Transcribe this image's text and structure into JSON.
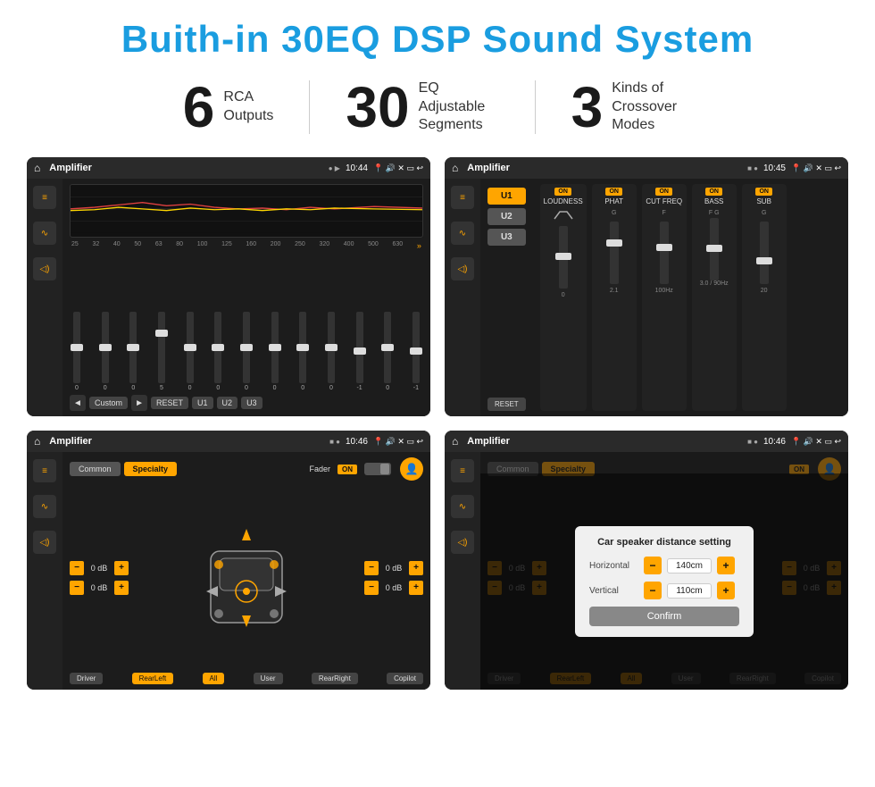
{
  "header": {
    "title": "Buith-in 30EQ DSP Sound System"
  },
  "stats": [
    {
      "number": "6",
      "desc_line1": "RCA",
      "desc_line2": "Outputs"
    },
    {
      "number": "30",
      "desc_line1": "EQ Adjustable",
      "desc_line2": "Segments"
    },
    {
      "number": "3",
      "desc_line1": "Kinds of",
      "desc_line2": "Crossover Modes"
    }
  ],
  "screens": {
    "screen1": {
      "status": {
        "title": "Amplifier",
        "time": "10:44"
      },
      "freq_labels": [
        "25",
        "32",
        "40",
        "50",
        "63",
        "80",
        "100",
        "125",
        "160",
        "200",
        "250",
        "320",
        "400",
        "500",
        "630"
      ],
      "slider_values": [
        "0",
        "0",
        "0",
        "5",
        "0",
        "0",
        "0",
        "0",
        "0",
        "0",
        "-1",
        "0",
        "-1"
      ],
      "controls": [
        "Custom",
        "RESET",
        "U1",
        "U2",
        "U3"
      ]
    },
    "screen2": {
      "status": {
        "title": "Amplifier",
        "time": "10:45"
      },
      "presets": [
        "U1",
        "U2",
        "U3"
      ],
      "channels": [
        {
          "label": "LOUDNESS",
          "on": true
        },
        {
          "label": "PHAT",
          "on": true
        },
        {
          "label": "CUT FREQ",
          "on": true
        },
        {
          "label": "BASS",
          "on": true
        },
        {
          "label": "SUB",
          "on": true
        }
      ],
      "reset": "RESET"
    },
    "screen3": {
      "status": {
        "title": "Amplifier",
        "time": "10:46"
      },
      "tabs": [
        "Common",
        "Specialty"
      ],
      "fader": "Fader",
      "fader_on": "ON",
      "db_values": [
        "0 dB",
        "0 dB",
        "0 dB",
        "0 dB"
      ],
      "bottom_buttons": [
        "Driver",
        "RearLeft",
        "All",
        "User",
        "RearRight",
        "Copilot"
      ]
    },
    "screen4": {
      "status": {
        "title": "Amplifier",
        "time": "10:46"
      },
      "tabs": [
        "Common",
        "Specialty"
      ],
      "fader_on": "ON",
      "db_values": [
        "0 dB",
        "0 dB"
      ],
      "dialog": {
        "title": "Car speaker distance setting",
        "horizontal_label": "Horizontal",
        "horizontal_value": "140cm",
        "vertical_label": "Vertical",
        "vertical_value": "110cm",
        "confirm_btn": "Confirm"
      },
      "bottom_buttons": [
        "Driver",
        "RearLeft",
        "All",
        "User",
        "RearRight",
        "Copilot"
      ]
    }
  }
}
